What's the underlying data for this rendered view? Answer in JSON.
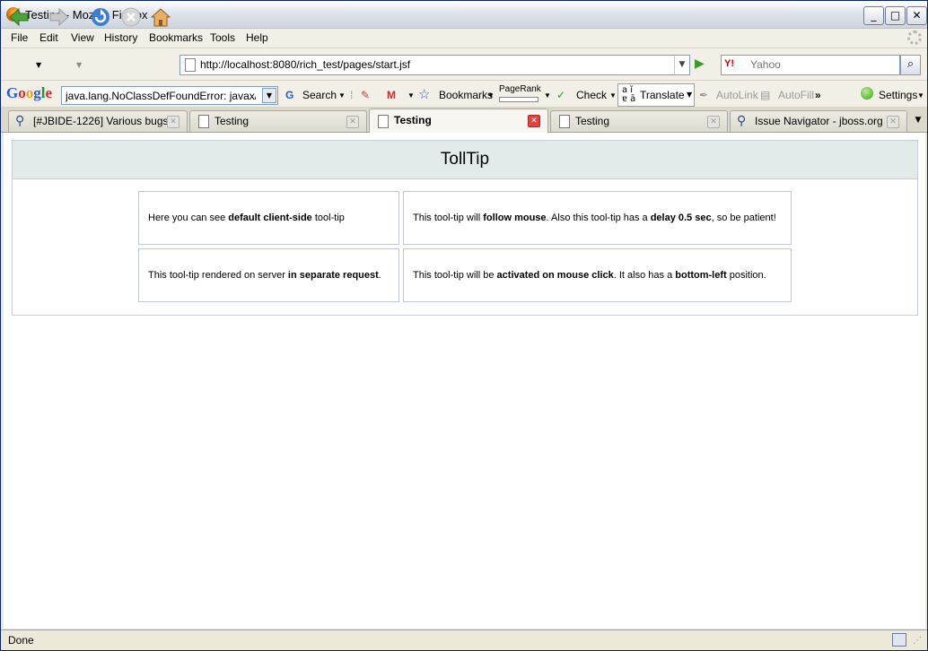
{
  "window": {
    "title": "Testing - Mozilla Firefox"
  },
  "menu": [
    "File",
    "Edit",
    "View",
    "History",
    "Bookmarks",
    "Tools",
    "Help"
  ],
  "nav": {
    "url": "http://localhost:8080/rich_test/pages/start.jsf",
    "search_placeholder": "Yahoo",
    "search_engine": "Y!"
  },
  "google_toolbar": {
    "logo": "Google",
    "query": "java.lang.NoClassDefFoundError: javax/el/C",
    "search_label": "Search",
    "bookmarks_label": "Bookmarks",
    "pagerank_label": "PageRank",
    "check_label": "Check",
    "translate_label": "Translate",
    "autolink_label": "AutoLink",
    "autofill_label": "AutoFill",
    "more_label": "»",
    "settings_label": "Settings"
  },
  "tabs": [
    {
      "label": "[#JBIDE-1226] Various bugs...",
      "icon": "jboss-icon"
    },
    {
      "label": "Testing",
      "icon": "page-icon"
    },
    {
      "label": "Testing",
      "icon": "page-icon",
      "active": true
    },
    {
      "label": "Testing",
      "icon": "page-icon"
    },
    {
      "label": "Issue Navigator - jboss.org ...",
      "icon": "jboss-icon"
    }
  ],
  "page": {
    "title": "TollTip",
    "cells": [
      {
        "pre": "Here you can see ",
        "b1": "default client-side",
        "mid": " tool-tip",
        "b2": "",
        "post": "",
        "b3": "",
        "end": ""
      },
      {
        "pre": "This tool-tip will ",
        "b1": "follow mouse",
        "mid": ". Also this tool-tip has a ",
        "b2": "delay 0.5 sec",
        "post": ", so be patient!",
        "b3": "",
        "end": ""
      },
      {
        "pre": "This tool-tip rendered on server ",
        "b1": "in separate request",
        "mid": ".",
        "b2": "",
        "post": "",
        "b3": "",
        "end": ""
      },
      {
        "pre": "This tool-tip will be ",
        "b1": "activated on mouse click",
        "mid": ". It also has a ",
        "b2": "bottom-left",
        "post": " position.",
        "b3": "",
        "end": ""
      }
    ]
  },
  "status": {
    "text": "Done"
  }
}
